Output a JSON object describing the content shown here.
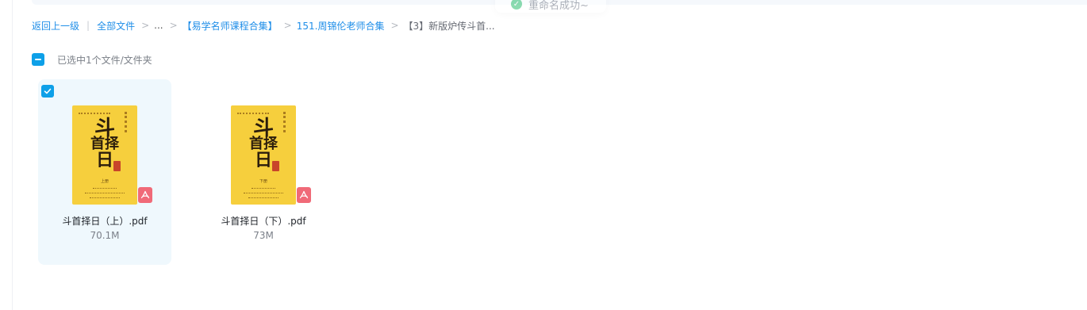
{
  "toast": {
    "text": "重命名成功~",
    "icon": "check-circle-icon",
    "color": "#2fbf71"
  },
  "breadcrumb": {
    "back": "返回上一级",
    "divider": "|",
    "all_files": "全部文件",
    "sep": ">",
    "ellipsis": "...",
    "level1": "【易学名师课程合集】",
    "level2": "151.周锦伦老师合集",
    "current": "【3】新版炉传斗首..."
  },
  "selection": {
    "text": "已选中1个文件/文件夹",
    "state": "indeterminate"
  },
  "files": [
    {
      "name": "斗首择日（上）.pdf",
      "size": "70.1M",
      "selected": true,
      "type_icon": "pdf-icon",
      "cover": {
        "title_chars": [
          "斗",
          "首择",
          "日"
        ],
        "volume": "上册"
      }
    },
    {
      "name": "斗首择日（下）.pdf",
      "size": "73M",
      "selected": false,
      "type_icon": "pdf-icon",
      "cover": {
        "title_chars": [
          "斗",
          "首择",
          "日"
        ],
        "volume": "下册"
      }
    }
  ],
  "colors": {
    "accent": "#0ea0e8",
    "link": "#1f8ee8",
    "selected_bg": "#eff8fd",
    "pdf_badge": "#f06a78",
    "cover": "#f6cf3d"
  }
}
